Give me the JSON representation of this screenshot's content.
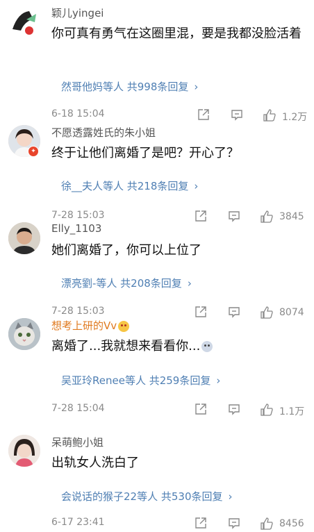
{
  "comments": [
    {
      "name": "颖儿yingei",
      "text": "你可真有勇气在这圈里混，要是我都没脸活着",
      "replies": "然哥他妈等人  共998条回复",
      "date": "6-18 15:04",
      "likes": "1.2万"
    },
    {
      "name": "不愿透露姓氏的朱小姐",
      "text": "终于让他们离婚了是吧？开心了？",
      "replies": "徐__夫人等人  共218条回复",
      "date": "7-28 15:03",
      "likes": "3845"
    },
    {
      "name": "Elly_1103",
      "text": "她们离婚了，你可以上位了",
      "replies": "漂亮劉-等人  共208条回复",
      "date": "7-28 15:03",
      "likes": "8074"
    },
    {
      "name": "想考上研的Vv",
      "text": "离婚了...我就想来看看你...",
      "replies": "吴亚玲Renee等人  共259条回复",
      "date": "7-28 15:04",
      "likes": "1.1万"
    },
    {
      "name": "呆萌鲍小姐",
      "text": "出轨女人洗白了",
      "replies": "会说话的猴子22等人  共530条回复",
      "date": "6-17 23:41",
      "likes": "8456"
    }
  ],
  "chevron": "›"
}
